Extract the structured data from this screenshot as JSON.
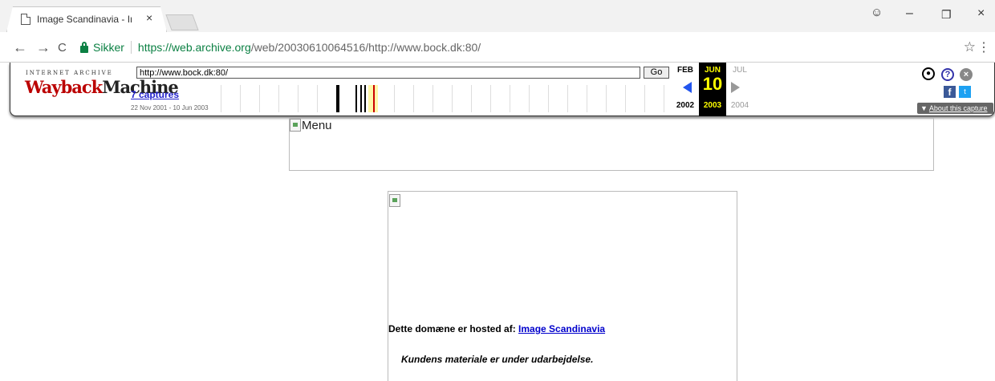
{
  "tab": {
    "title": "Image Scandinavia - Inte",
    "close": "×"
  },
  "window": {
    "account": "☺",
    "minimize": "–",
    "restore": "❐",
    "close": "×"
  },
  "toolbar": {
    "back": "←",
    "forward": "→",
    "reload": "C",
    "secure_label": "Sikker",
    "url_main": "https://web.archive.org",
    "url_rest": "/web/20030610064516/http://www.bock.dk:80/",
    "star": "☆",
    "menu": "⋮"
  },
  "wayback": {
    "logo_top": "INTERNET ARCHIVE",
    "logo_a": "Wayback",
    "logo_b": "Machine",
    "url_value": "http://www.bock.dk:80/",
    "go_label": "Go",
    "captures": "7 captures",
    "range": "22 Nov 2001 - 10 Jun 2003",
    "prev_month": "FEB",
    "cur_month": "JUN",
    "next_month": "JUL",
    "cur_day": "10",
    "prev_year": "2002",
    "cur_year": "2003",
    "next_year": "2004",
    "about": "About this capture"
  },
  "page": {
    "menu_alt": "Menu",
    "hosted_prefix": "Dette domæne er hosted af: ",
    "hosted_link": "Image Scandinavia",
    "material": "Kundens materiale er under udarbejdelse."
  }
}
